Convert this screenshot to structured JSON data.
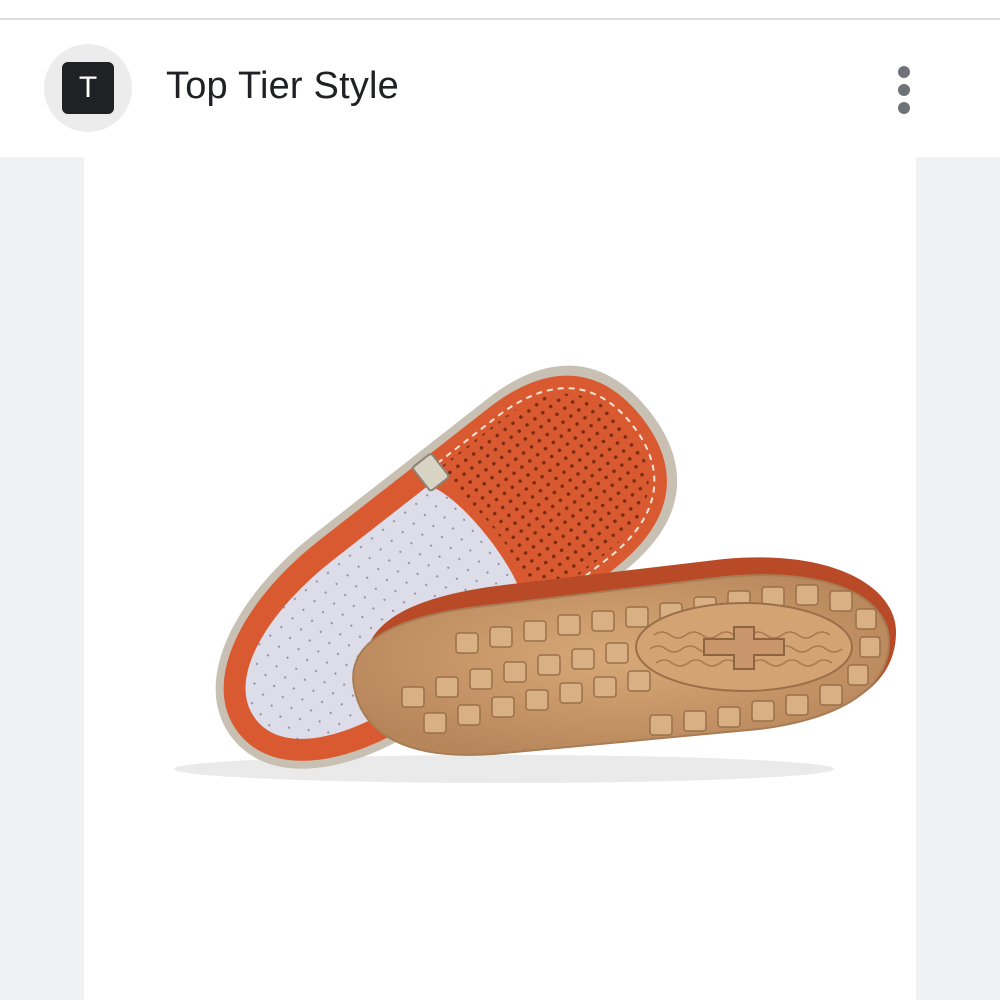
{
  "header": {
    "avatar_letter": "T",
    "title": "Top Tier Style",
    "more_icon": "more-vertical-icon"
  },
  "main": {
    "image_description_icon": "product-photo"
  },
  "colors": {
    "avatar_bg": "#202124",
    "leather": "#d9572d",
    "sole": "#c79666",
    "content_bg": "#eff1f3"
  }
}
